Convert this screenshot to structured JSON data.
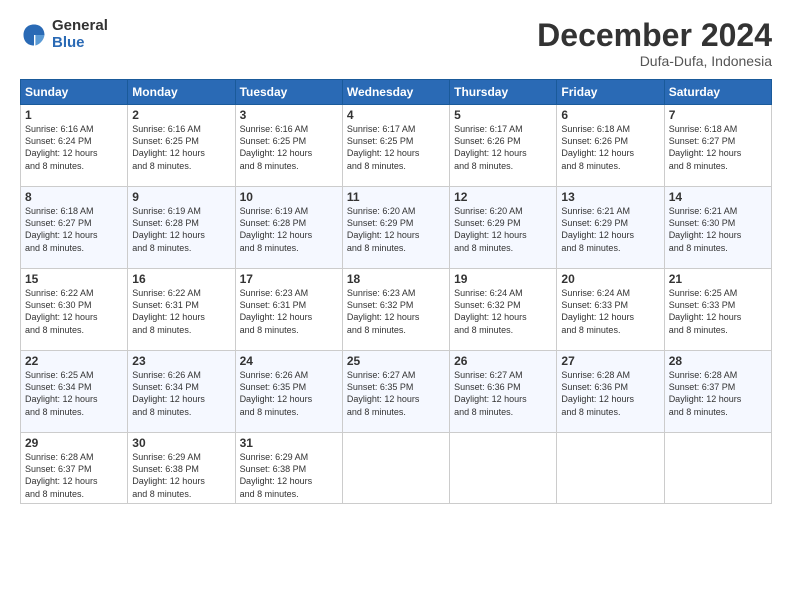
{
  "logo": {
    "general": "General",
    "blue": "Blue"
  },
  "title": "December 2024",
  "location": "Dufa-Dufa, Indonesia",
  "days_of_week": [
    "Sunday",
    "Monday",
    "Tuesday",
    "Wednesday",
    "Thursday",
    "Friday",
    "Saturday"
  ],
  "weeks": [
    [
      {
        "day": "1",
        "sunrise": "6:16 AM",
        "sunset": "6:24 PM",
        "daylight": "12 hours and 8 minutes."
      },
      {
        "day": "2",
        "sunrise": "6:16 AM",
        "sunset": "6:25 PM",
        "daylight": "12 hours and 8 minutes."
      },
      {
        "day": "3",
        "sunrise": "6:16 AM",
        "sunset": "6:25 PM",
        "daylight": "12 hours and 8 minutes."
      },
      {
        "day": "4",
        "sunrise": "6:17 AM",
        "sunset": "6:25 PM",
        "daylight": "12 hours and 8 minutes."
      },
      {
        "day": "5",
        "sunrise": "6:17 AM",
        "sunset": "6:26 PM",
        "daylight": "12 hours and 8 minutes."
      },
      {
        "day": "6",
        "sunrise": "6:18 AM",
        "sunset": "6:26 PM",
        "daylight": "12 hours and 8 minutes."
      },
      {
        "day": "7",
        "sunrise": "6:18 AM",
        "sunset": "6:27 PM",
        "daylight": "12 hours and 8 minutes."
      }
    ],
    [
      {
        "day": "8",
        "sunrise": "6:18 AM",
        "sunset": "6:27 PM",
        "daylight": "12 hours and 8 minutes."
      },
      {
        "day": "9",
        "sunrise": "6:19 AM",
        "sunset": "6:28 PM",
        "daylight": "12 hours and 8 minutes."
      },
      {
        "day": "10",
        "sunrise": "6:19 AM",
        "sunset": "6:28 PM",
        "daylight": "12 hours and 8 minutes."
      },
      {
        "day": "11",
        "sunrise": "6:20 AM",
        "sunset": "6:29 PM",
        "daylight": "12 hours and 8 minutes."
      },
      {
        "day": "12",
        "sunrise": "6:20 AM",
        "sunset": "6:29 PM",
        "daylight": "12 hours and 8 minutes."
      },
      {
        "day": "13",
        "sunrise": "6:21 AM",
        "sunset": "6:29 PM",
        "daylight": "12 hours and 8 minutes."
      },
      {
        "day": "14",
        "sunrise": "6:21 AM",
        "sunset": "6:30 PM",
        "daylight": "12 hours and 8 minutes."
      }
    ],
    [
      {
        "day": "15",
        "sunrise": "6:22 AM",
        "sunset": "6:30 PM",
        "daylight": "12 hours and 8 minutes."
      },
      {
        "day": "16",
        "sunrise": "6:22 AM",
        "sunset": "6:31 PM",
        "daylight": "12 hours and 8 minutes."
      },
      {
        "day": "17",
        "sunrise": "6:23 AM",
        "sunset": "6:31 PM",
        "daylight": "12 hours and 8 minutes."
      },
      {
        "day": "18",
        "sunrise": "6:23 AM",
        "sunset": "6:32 PM",
        "daylight": "12 hours and 8 minutes."
      },
      {
        "day": "19",
        "sunrise": "6:24 AM",
        "sunset": "6:32 PM",
        "daylight": "12 hours and 8 minutes."
      },
      {
        "day": "20",
        "sunrise": "6:24 AM",
        "sunset": "6:33 PM",
        "daylight": "12 hours and 8 minutes."
      },
      {
        "day": "21",
        "sunrise": "6:25 AM",
        "sunset": "6:33 PM",
        "daylight": "12 hours and 8 minutes."
      }
    ],
    [
      {
        "day": "22",
        "sunrise": "6:25 AM",
        "sunset": "6:34 PM",
        "daylight": "12 hours and 8 minutes."
      },
      {
        "day": "23",
        "sunrise": "6:26 AM",
        "sunset": "6:34 PM",
        "daylight": "12 hours and 8 minutes."
      },
      {
        "day": "24",
        "sunrise": "6:26 AM",
        "sunset": "6:35 PM",
        "daylight": "12 hours and 8 minutes."
      },
      {
        "day": "25",
        "sunrise": "6:27 AM",
        "sunset": "6:35 PM",
        "daylight": "12 hours and 8 minutes."
      },
      {
        "day": "26",
        "sunrise": "6:27 AM",
        "sunset": "6:36 PM",
        "daylight": "12 hours and 8 minutes."
      },
      {
        "day": "27",
        "sunrise": "6:28 AM",
        "sunset": "6:36 PM",
        "daylight": "12 hours and 8 minutes."
      },
      {
        "day": "28",
        "sunrise": "6:28 AM",
        "sunset": "6:37 PM",
        "daylight": "12 hours and 8 minutes."
      }
    ],
    [
      {
        "day": "29",
        "sunrise": "6:28 AM",
        "sunset": "6:37 PM",
        "daylight": "12 hours and 8 minutes."
      },
      {
        "day": "30",
        "sunrise": "6:29 AM",
        "sunset": "6:38 PM",
        "daylight": "12 hours and 8 minutes."
      },
      {
        "day": "31",
        "sunrise": "6:29 AM",
        "sunset": "6:38 PM",
        "daylight": "12 hours and 8 minutes."
      },
      null,
      null,
      null,
      null
    ]
  ],
  "labels": {
    "sunrise": "Sunrise:",
    "sunset": "Sunset:",
    "daylight": "Daylight:"
  }
}
